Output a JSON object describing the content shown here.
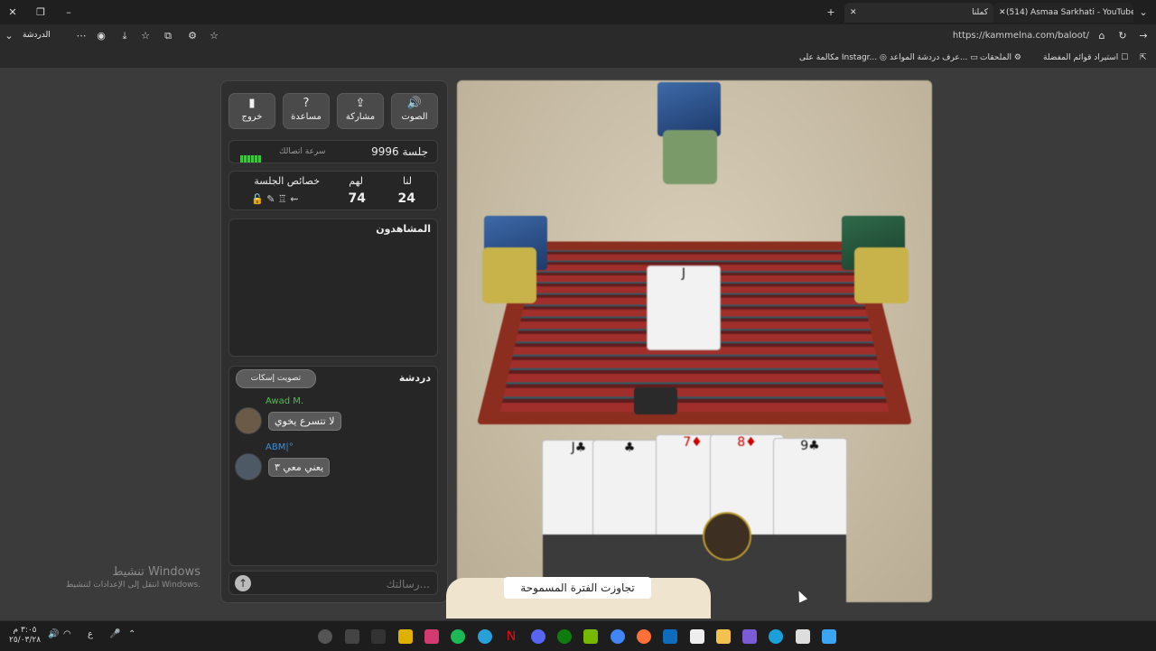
{
  "tabs": [
    {
      "label": "(514) Asmaa Sarkhati - YouTube"
    },
    {
      "label": "كملنا"
    }
  ],
  "address": {
    "url": "https://kammelna.com/baloot/"
  },
  "toolbar_left": {
    "chat_label": "الدردشة"
  },
  "bookmarks": [
    {
      "label": "استيراد قوائم المفضلة"
    },
    {
      "label": "الملحقات"
    },
    {
      "label": "عرف دردشة المواعد..."
    },
    {
      "label": "مكالمة على Instagr..."
    }
  ],
  "side": {
    "buttons": [
      {
        "label": "الصوت",
        "icon": "speaker-icon",
        "glyph": "🔊"
      },
      {
        "label": "مشاركة",
        "icon": "share-icon",
        "glyph": "⇪"
      },
      {
        "label": "مساعدة",
        "icon": "help-icon",
        "glyph": "?"
      },
      {
        "label": "خروج",
        "icon": "exit-icon",
        "glyph": "▮"
      }
    ],
    "session": {
      "label": "جلسة 9996",
      "speed_label": "سرعة اتصالك"
    },
    "score": {
      "us_label": "لنا",
      "them_label": "لهم",
      "props_label": "خصائص الجلسة",
      "us": "24",
      "them": "74"
    },
    "spectators": {
      "title": "المشاهدون"
    },
    "chat": {
      "title": "دردشة",
      "mute_button": "تصويت إسكات",
      "messages": [
        {
          "name": "Awad M.",
          "text": "لا تتسرع يخوي",
          "name_color": "#4cc04c"
        },
        {
          "name": "ABM|°",
          "text": "يعني معي ٣",
          "name_color": "#3b8fd9"
        }
      ],
      "input_placeholder": "رسالتك..."
    }
  },
  "game": {
    "timeout_text": "تجاوزت الفترة المسموحة"
  },
  "watermark": {
    "line1": "تنشيط Windows",
    "line2": "انتقل إلى الإعدادات لتنشيط Windows."
  },
  "taskbar": {
    "time": "٣:٠٥ م",
    "date": "٢٥/٠٣/٢٨"
  }
}
